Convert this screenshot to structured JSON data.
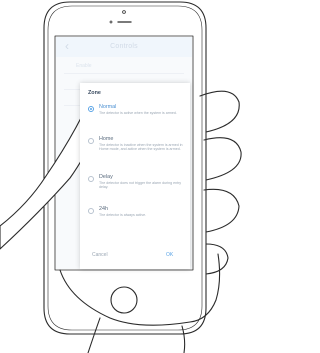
{
  "app_bar": {
    "back_icon": "chevron-left-icon",
    "title": "Controls"
  },
  "list": {
    "first_item": "Enable"
  },
  "dialog": {
    "title": "Zone",
    "options": [
      {
        "label": "Normal",
        "description": "The detector is active when the system is armed.",
        "selected": true
      },
      {
        "label": "Home",
        "description": "The detector is inactive when the system is armed in Home mode, and active when the system is armed.",
        "selected": false
      },
      {
        "label": "Delay",
        "description": "The detector does not trigger the alarm during entry delay.",
        "selected": false
      },
      {
        "label": "24h",
        "description": "The detector is always active.",
        "selected": false
      }
    ],
    "cancel_label": "Cancel",
    "ok_label": "OK"
  },
  "colors": {
    "accent": "#5aa4e6",
    "appbar": "#e9f1fa",
    "line": "#2b2b2b"
  }
}
